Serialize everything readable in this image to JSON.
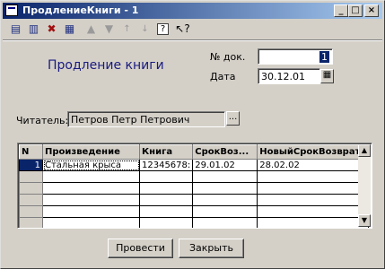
{
  "window": {
    "title": "ПродлениеКниги - 1"
  },
  "title_buttons": {
    "minimize": "_",
    "maximize": "□",
    "close": "×"
  },
  "toolbar": {
    "icons": [
      "new-doc-icon",
      "copy-doc-icon",
      "delete-doc-icon",
      "edit-doc-icon",
      "move-up-icon",
      "move-down-icon",
      "sort-asc-icon",
      "sort-desc-icon",
      "help-icon",
      "whats-this-icon"
    ]
  },
  "header": {
    "form_title": "Продление книги",
    "doc_number_label": "№ док.",
    "doc_number_value": "1",
    "date_label": "Дата",
    "date_value": "30.12.01"
  },
  "reader": {
    "label": "Читатель:",
    "value": "Петров Петр Петрович",
    "select_button": "..."
  },
  "table": {
    "columns": [
      "N",
      "Произведение",
      "Книга",
      "СрокВоз...",
      "НовыйСрокВозврата"
    ],
    "rows": [
      [
        "1",
        "Стальная крыса",
        "12345678:",
        "29.01.02",
        "28.02.02"
      ]
    ]
  },
  "buttons": {
    "post": "Провести",
    "close": "Закрыть"
  }
}
